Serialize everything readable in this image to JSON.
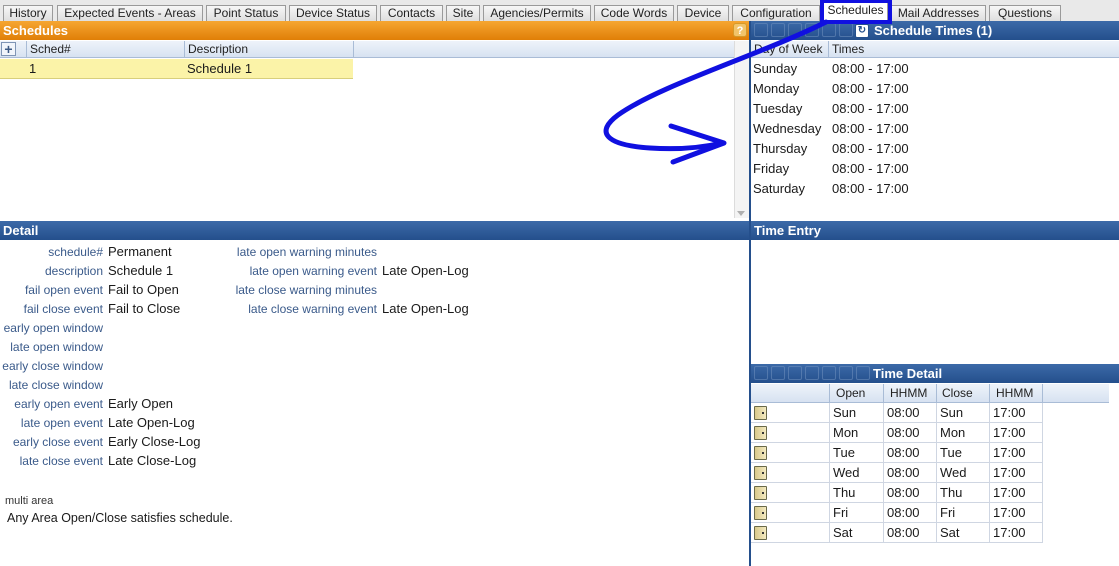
{
  "tabs": [
    {
      "label": "History",
      "active": false
    },
    {
      "label": "Expected Events - Areas",
      "active": false
    },
    {
      "label": "Point Status",
      "active": false
    },
    {
      "label": "Device Status",
      "active": false
    },
    {
      "label": "Contacts",
      "active": false
    },
    {
      "label": "Site",
      "active": false
    },
    {
      "label": "Agencies/Permits",
      "active": false
    },
    {
      "label": "Code Words",
      "active": false
    },
    {
      "label": "Device",
      "active": false
    },
    {
      "label": "Configuration",
      "active": false
    },
    {
      "label": "Schedules",
      "active": true
    },
    {
      "label": "Mail Addresses",
      "active": false
    },
    {
      "label": "Questions",
      "active": false
    }
  ],
  "schedules": {
    "title": "Schedules",
    "help": "?",
    "add": "+",
    "columns": [
      "Sched#",
      "Description"
    ],
    "rows": [
      {
        "sched": "1",
        "description": "Schedule 1"
      }
    ]
  },
  "schedule_times": {
    "title": "Schedule Times (1)",
    "columns": [
      "Day of Week",
      "Times"
    ],
    "rows": [
      {
        "day": "Sunday",
        "times": "08:00 - 17:00"
      },
      {
        "day": "Monday",
        "times": "08:00 - 17:00"
      },
      {
        "day": "Tuesday",
        "times": "08:00 - 17:00"
      },
      {
        "day": "Wednesday",
        "times": "08:00 - 17:00"
      },
      {
        "day": "Thursday",
        "times": "08:00 - 17:00"
      },
      {
        "day": "Friday",
        "times": "08:00 - 17:00"
      },
      {
        "day": "Saturday",
        "times": "08:00 - 17:00"
      }
    ]
  },
  "detail": {
    "title": "Detail",
    "left_fields": [
      {
        "label": "schedule#",
        "value": "Permanent"
      },
      {
        "label": "description",
        "value": "Schedule 1"
      },
      {
        "label": "fail open event",
        "value": "Fail to Open"
      },
      {
        "label": "fail close event",
        "value": "Fail to Close"
      },
      {
        "label": "early open window",
        "value": ""
      },
      {
        "label": "late open window",
        "value": ""
      },
      {
        "label": "early close window",
        "value": ""
      },
      {
        "label": "late close window",
        "value": ""
      },
      {
        "label": "early open event",
        "value": "Early Open"
      },
      {
        "label": "late open event",
        "value": "Late Open-Log"
      },
      {
        "label": "early close event",
        "value": "Early Close-Log"
      },
      {
        "label": "late close event",
        "value": "Late Close-Log"
      }
    ],
    "right_fields": [
      {
        "label": "late open warning minutes",
        "value": ""
      },
      {
        "label": "late open warning event",
        "value": "Late Open-Log"
      },
      {
        "label": "late close warning minutes",
        "value": ""
      },
      {
        "label": "late close warning event",
        "value": "Late Open-Log"
      }
    ],
    "multi_area_label": "multi area",
    "multi_area_value": "Any Area Open/Close satisfies schedule."
  },
  "time_entry": {
    "title": "Time Entry"
  },
  "time_detail": {
    "title": "Time Detail",
    "columns": [
      "Open",
      "HHMM",
      "Close",
      "HHMM"
    ],
    "rows": [
      {
        "open": "Sun",
        "open_time": "08:00",
        "close": "Sun",
        "close_time": "17:00"
      },
      {
        "open": "Mon",
        "open_time": "08:00",
        "close": "Mon",
        "close_time": "17:00"
      },
      {
        "open": "Tue",
        "open_time": "08:00",
        "close": "Tue",
        "close_time": "17:00"
      },
      {
        "open": "Wed",
        "open_time": "08:00",
        "close": "Wed",
        "close_time": "17:00"
      },
      {
        "open": "Thu",
        "open_time": "08:00",
        "close": "Thu",
        "close_time": "17:00"
      },
      {
        "open": "Fri",
        "open_time": "08:00",
        "close": "Fri",
        "close_time": "17:00"
      },
      {
        "open": "Sat",
        "open_time": "08:00",
        "close": "Sat",
        "close_time": "17:00"
      }
    ]
  },
  "colors": {
    "panel_orange": "#e8890f",
    "panel_blue": "#244f8c",
    "selected_row": "#fbf3a8",
    "annotation": "#1010e0"
  }
}
